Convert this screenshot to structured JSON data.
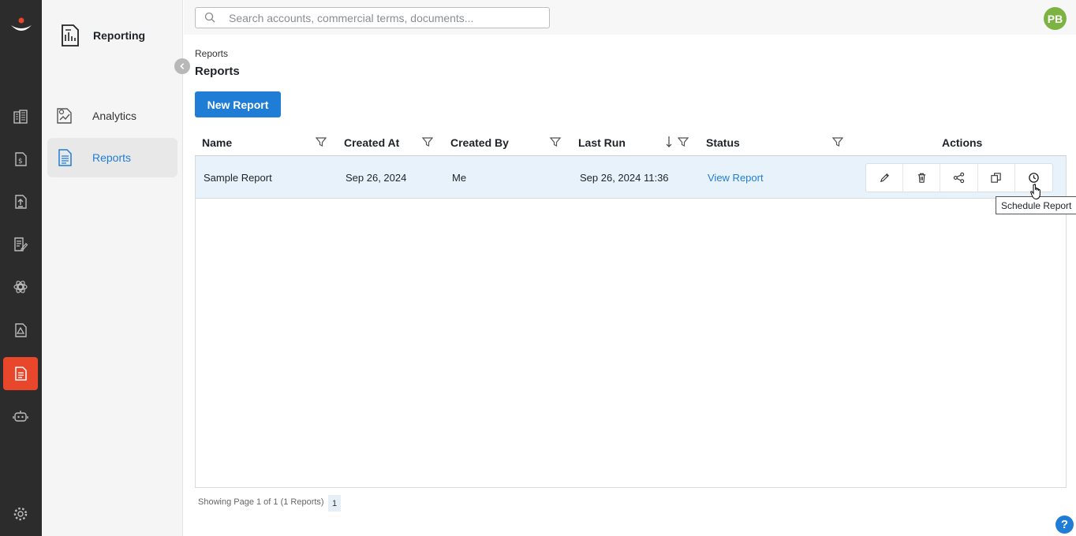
{
  "sidebar": {
    "title": "Reporting",
    "items": [
      {
        "label": "Analytics",
        "icon": "analytics-icon",
        "active": false
      },
      {
        "label": "Reports",
        "icon": "report-doc-icon",
        "active": true
      }
    ]
  },
  "rail": {
    "icons": [
      "building-icon",
      "dollar-doc-icon",
      "upload-doc-icon",
      "edit-doc-icon",
      "gear-atom-icon",
      "alert-doc-icon",
      "report-doc-icon",
      "bot-icon",
      "settings-icon"
    ],
    "active_index": 6
  },
  "search": {
    "placeholder": "Search accounts, commercial terms, documents..."
  },
  "user": {
    "initials": "PB"
  },
  "breadcrumb": "Reports",
  "page_title": "Reports",
  "new_report_label": "New Report",
  "table": {
    "columns": [
      "Name",
      "Created At",
      "Created By",
      "Last Run",
      "Status",
      "Actions"
    ],
    "rows": [
      {
        "name": "Sample Report",
        "created_at": "Sep 26, 2024",
        "created_by": "Me",
        "last_run": "Sep 26, 2024 11:36",
        "status": "View Report"
      }
    ],
    "actions": [
      "edit",
      "delete",
      "share",
      "copy",
      "schedule"
    ]
  },
  "tooltip": "Schedule Report",
  "pager": {
    "text": "Showing Page 1 of 1 (1 Reports)",
    "page": "1"
  },
  "help": "?",
  "colors": {
    "accent": "#1f7dd6",
    "rail": "#2c2c2c",
    "active_rail": "#e8472b",
    "avatar": "#7cb342"
  }
}
